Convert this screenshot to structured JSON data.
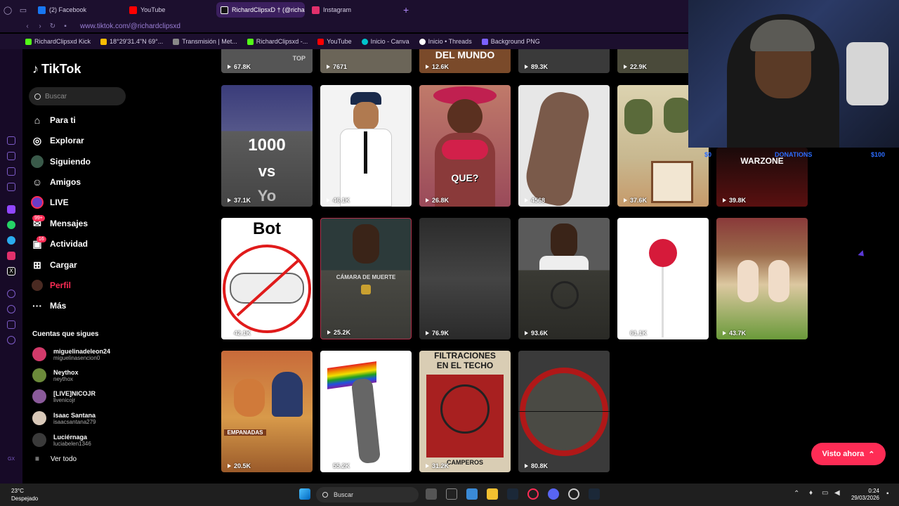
{
  "browser": {
    "tabs": [
      {
        "label": "(2) Facebook",
        "color": "#1877f2"
      },
      {
        "label": "YouTube",
        "color": "#ff0000"
      },
      {
        "label": "RichardClipsxD † (@richa",
        "color": "#000000",
        "active": true
      },
      {
        "label": "Instagram",
        "color": "#e1306c"
      }
    ],
    "new_tab": "+",
    "url": "www.tiktok.com/@richardclipsxd",
    "bookmarks": [
      {
        "label": "RichardClipsxd Kick",
        "color": "#53fc18"
      },
      {
        "label": "18°29'31.4\"N 69°...",
        "color": "#fbbc04"
      },
      {
        "label": "Transmisión | Met...",
        "color": "#888888"
      },
      {
        "label": "RichardClipsxd -...",
        "color": "#53fc18"
      },
      {
        "label": "YouTube",
        "color": "#ff0000"
      },
      {
        "label": "Inicio - Canva",
        "color": "#00c4cc"
      },
      {
        "label": "Inicio • Threads",
        "color": "#ffffff"
      },
      {
        "label": "Background PNG",
        "color": "#7b61ff"
      }
    ]
  },
  "tiktok": {
    "logo": "TikTok",
    "search_placeholder": "Buscar",
    "menu": [
      {
        "label": "Para ti",
        "icon": "home-icon"
      },
      {
        "label": "Explorar",
        "icon": "compass-icon"
      },
      {
        "label": "Siguiendo",
        "icon": "avatar-icon"
      },
      {
        "label": "Amigos",
        "icon": "friends-icon"
      },
      {
        "label": "LIVE",
        "icon": "live-icon"
      },
      {
        "label": "Mensajes",
        "icon": "messages-icon",
        "badge": "99+"
      },
      {
        "label": "Actividad",
        "icon": "activity-icon",
        "badge": "16"
      },
      {
        "label": "Cargar",
        "icon": "upload-icon"
      },
      {
        "label": "Perfil",
        "icon": "profile-icon"
      },
      {
        "label": "Más",
        "icon": "more-icon"
      }
    ],
    "following_title": "Cuentas que sigues",
    "following": [
      {
        "name": "miguelinadeleon24",
        "handle": "miguelinasencion0"
      },
      {
        "name": "Neythox",
        "handle": "neythox"
      },
      {
        "name": "[LIVE]NICOJR",
        "handle": "livenicojr"
      },
      {
        "name": "Isaac Santana",
        "handle": "isaacsantana279"
      },
      {
        "name": "Luciérnaga",
        "handle": "luciabelen1346"
      }
    ],
    "see_all": "Ver todo"
  },
  "videos": {
    "row0": [
      "67.8K",
      "7671",
      "12.6K",
      "89.3K",
      "22.9K"
    ],
    "row0_text": [
      "TOP",
      "",
      "DEL MUNDO",
      "",
      ""
    ],
    "row1": [
      "37.1K",
      "46.1K",
      "26.8K",
      "4568",
      "37.6K",
      "39.8K"
    ],
    "row1_text": {
      "t1": "1000",
      "t2": "vs",
      "t3": "Yo",
      "que": "QUE?",
      "warzone": "WARZONE"
    },
    "row2": [
      "42.1K",
      "25.2K",
      "76.9K",
      "93.6K",
      "61.1K",
      "43.7K"
    ],
    "row2_text": {
      "bot": "Bot",
      "camara": "CÁMARA DE MUERTE"
    },
    "row3": [
      "20.5K",
      "55.2K",
      "31.2K",
      "80.8K"
    ],
    "row3_text": {
      "empanadas": "EMPANADAS",
      "filtr1": "FILTRACIONES",
      "filtr2": "EN EL TECHO",
      "filtr3": "CAMPEROS"
    }
  },
  "stream_overlay": {
    "left": "$0",
    "center": "DONATIONS",
    "right": "$100"
  },
  "visto_ahora": "Visto ahora",
  "taskbar": {
    "temp": "23°C",
    "weather": "Despejado",
    "search": "Buscar",
    "time": "0:24",
    "date": "29/03/2026"
  }
}
